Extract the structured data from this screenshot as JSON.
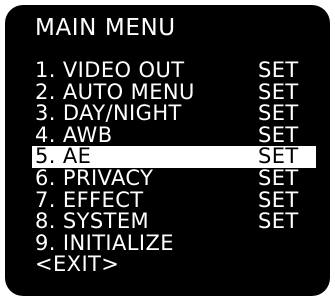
{
  "menu": {
    "title": "MAIN MENU",
    "items": [
      {
        "label": "1. VIDEO OUT",
        "value": "SET",
        "selected": false
      },
      {
        "label": "2. AUTO MENU",
        "value": "SET",
        "selected": false
      },
      {
        "label": "3. DAY/NIGHT",
        "value": "SET",
        "selected": false
      },
      {
        "label": "4. AWB",
        "value": "SET",
        "selected": false
      },
      {
        "label": "5. AE",
        "value": "SET",
        "selected": true
      },
      {
        "label": "6. PRIVACY",
        "value": "SET",
        "selected": false
      },
      {
        "label": "7. EFFECT",
        "value": "SET",
        "selected": false
      },
      {
        "label": "8. SYSTEM",
        "value": "SET",
        "selected": false
      },
      {
        "label": "9. INITIALIZE",
        "value": "",
        "selected": false
      },
      {
        "label": "<EXIT>",
        "value": "",
        "selected": false
      }
    ]
  },
  "colors": {
    "background": "#000000",
    "text": "#ffffff",
    "highlight_bg": "#ffffff",
    "highlight_text": "#000000"
  }
}
